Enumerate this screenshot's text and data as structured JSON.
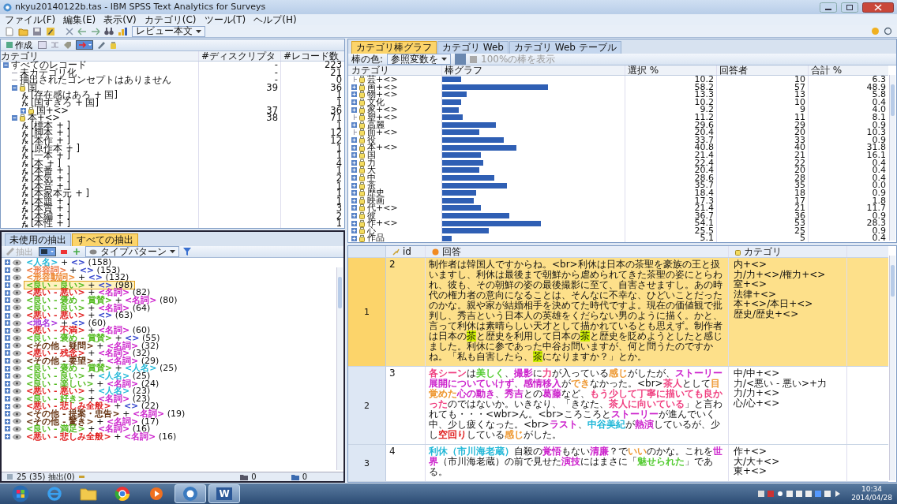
{
  "window": {
    "title": "nkyu20140122b.tas - IBM SPSS Text Analytics for Surveys"
  },
  "menu": [
    "ファイル(F)",
    "編集(E)",
    "表示(V)",
    "カテゴリ(C)",
    "ツール(T)",
    "ヘルプ(H)"
  ],
  "toolbar": {
    "view_dropdown": "レビュー本文"
  },
  "categories": {
    "create_button": "作成",
    "columns": [
      "カテゴリ",
      "#ディスクリプタ",
      "#レコード数"
    ],
    "rows": [
      {
        "label": "すべてのレコード",
        "descriptors": "-",
        "records": "223",
        "expanded": true,
        "children": [
          {
            "kind": "plain",
            "label": "未カテゴリ化",
            "descriptors": "-",
            "records": "21"
          },
          {
            "kind": "plain",
            "label": "抽出されたコンセプトはありません",
            "descriptors": "-",
            "records": "0"
          },
          {
            "kind": "category",
            "label": "国",
            "descriptors": "39",
            "records": "36",
            "expanded": true,
            "children": [
              {
                "kind": "descriptor",
                "label": "[存在感はあろ + 国]",
                "records": "1"
              },
              {
                "kind": "descriptor",
                "label": "[国すぎろ + 国]",
                "records": "1"
              },
              {
                "kind": "category",
                "label": "国+<>",
                "descriptors": "37",
                "records": "36",
                "expanded": false
              }
            ]
          },
          {
            "kind": "category",
            "label": "本+<>",
            "descriptors": "38",
            "records": "71",
            "expanded": true,
            "children": [
              {
                "kind": "descriptor",
                "label": "[標本 + ]",
                "records": "1"
              },
              {
                "kind": "descriptor",
                "label": "[脚本 + ]",
                "records": "12"
              },
              {
                "kind": "descriptor",
                "label": "[本作 + ]",
                "records": "12"
              },
              {
                "kind": "descriptor",
                "label": "[原作本 + ]",
                "records": "1"
              },
              {
                "kind": "descriptor",
                "label": "[一本 + ]",
                "records": "1"
              },
              {
                "kind": "descriptor",
                "label": "[本 + ]",
                "records": "4"
              },
              {
                "kind": "descriptor",
                "label": "[本番 + ]",
                "records": "1"
              },
              {
                "kind": "descriptor",
                "label": "[本気 + ]",
                "records": "2"
              },
              {
                "kind": "descriptor",
                "label": "[本音 + ]",
                "records": "1"
              },
              {
                "kind": "descriptor",
                "label": "[本家本元 + ]",
                "records": "1"
              },
              {
                "kind": "descriptor",
                "label": "[本題 + ]",
                "records": "1"
              },
              {
                "kind": "descriptor",
                "label": "[本質 + ]",
                "records": "3"
              },
              {
                "kind": "descriptor",
                "label": "[本編 + ]",
                "records": "2"
              },
              {
                "kind": "descriptor",
                "label": "[本性 + ]",
                "records": "1"
              }
            ]
          }
        ]
      }
    ]
  },
  "extractions": {
    "tabs": [
      {
        "label": "未使用の抽出",
        "selected": false
      },
      {
        "label": "すべての抽出",
        "selected": true
      }
    ],
    "extract_button": "抽出",
    "type_dropdown": "タイプパターン",
    "items": [
      {
        "selected": false,
        "parts": [
          {
            "text": "<人名>",
            "color": "#22b8d8"
          },
          {
            "text": " + "
          },
          {
            "text": "<>",
            "color": "#3344cc"
          }
        ],
        "count": " (158)"
      },
      {
        "selected": false,
        "parts": [
          {
            "text": "<形容詞>",
            "color": "#ee7744"
          },
          {
            "text": " + "
          },
          {
            "text": "<>",
            "color": "#3344cc"
          }
        ],
        "count": " (153)"
      },
      {
        "selected": false,
        "parts": [
          {
            "text": "<形容動詞>",
            "color": "#ee8833"
          },
          {
            "text": " + "
          },
          {
            "text": "<>",
            "color": "#3344cc"
          }
        ],
        "count": " (132)"
      },
      {
        "selected": true,
        "parts": [
          {
            "text": "<良い - 良い>",
            "color": "#55bb22"
          },
          {
            "text": " + "
          },
          {
            "text": "<>",
            "color": "#3344cc"
          }
        ],
        "count": " (98)"
      },
      {
        "selected": false,
        "parts": [
          {
            "text": "<悪い - 悪い>",
            "color": "#e02020"
          },
          {
            "text": " + "
          },
          {
            "text": "<名詞>",
            "color": "#cc22cc"
          }
        ],
        "count": " (82)"
      },
      {
        "selected": false,
        "parts": [
          {
            "text": "<良い - 褒め - 賞賛>",
            "color": "#55bb22"
          },
          {
            "text": " + "
          },
          {
            "text": "<名詞>",
            "color": "#cc22cc"
          }
        ],
        "count": " (80)"
      },
      {
        "selected": false,
        "parts": [
          {
            "text": "<良い - 良い>",
            "color": "#55bb22"
          },
          {
            "text": " + "
          },
          {
            "text": "<名詞>",
            "color": "#cc22cc"
          }
        ],
        "count": " (64)"
      },
      {
        "selected": false,
        "parts": [
          {
            "text": "<悪い - 悪い>",
            "color": "#e02020"
          },
          {
            "text": " + "
          },
          {
            "text": "<>",
            "color": "#3344cc"
          }
        ],
        "count": " (63)"
      },
      {
        "selected": false,
        "parts": [
          {
            "text": "<地名>",
            "color": "#aa33dd"
          },
          {
            "text": " + "
          },
          {
            "text": "<>",
            "color": "#3344cc"
          }
        ],
        "count": " (60)"
      },
      {
        "selected": false,
        "parts": [
          {
            "text": "<悪い - 不満>",
            "color": "#e02020"
          },
          {
            "text": " + "
          },
          {
            "text": "<名詞>",
            "color": "#cc22cc"
          }
        ],
        "count": " (60)"
      },
      {
        "selected": false,
        "parts": [
          {
            "text": "<良い - 褒め - 賞賛>",
            "color": "#55bb22"
          },
          {
            "text": " + "
          },
          {
            "text": "<>",
            "color": "#3344cc"
          }
        ],
        "count": " (55)"
      },
      {
        "selected": false,
        "parts": [
          {
            "text": "<その他 - 疑問>",
            "color": "#663311"
          },
          {
            "text": " + "
          },
          {
            "text": "<名詞>",
            "color": "#cc22cc"
          }
        ],
        "count": " (32)"
      },
      {
        "selected": false,
        "parts": [
          {
            "text": "<悪い - 残念>",
            "color": "#e02020"
          },
          {
            "text": " + "
          },
          {
            "text": "<名詞>",
            "color": "#cc22cc"
          }
        ],
        "count": " (32)"
      },
      {
        "selected": false,
        "parts": [
          {
            "text": "<その他 - 要望>",
            "color": "#663311"
          },
          {
            "text": " + "
          },
          {
            "text": "<名詞>",
            "color": "#cc22cc"
          }
        ],
        "count": " (29)"
      },
      {
        "selected": false,
        "parts": [
          {
            "text": "<良い - 褒め - 賞賛>",
            "color": "#55bb22"
          },
          {
            "text": " + "
          },
          {
            "text": "<人名>",
            "color": "#22b8d8"
          }
        ],
        "count": " (25)"
      },
      {
        "selected": false,
        "parts": [
          {
            "text": "<良い - 良い>",
            "color": "#55bb22"
          },
          {
            "text": " + "
          },
          {
            "text": "<人名>",
            "color": "#22b8d8"
          }
        ],
        "count": " (25)"
      },
      {
        "selected": false,
        "parts": [
          {
            "text": "<良い - 楽しい>",
            "color": "#55bb22"
          },
          {
            "text": " + "
          },
          {
            "text": "<名詞>",
            "color": "#cc22cc"
          }
        ],
        "count": " (24)"
      },
      {
        "selected": false,
        "parts": [
          {
            "text": "<悪い - 悪い>",
            "color": "#e02020"
          },
          {
            "text": " + "
          },
          {
            "text": "<人名>",
            "color": "#22b8d8"
          }
        ],
        "count": " (23)"
      },
      {
        "selected": false,
        "parts": [
          {
            "text": "<良い - 好き>",
            "color": "#55bb22"
          },
          {
            "text": " + "
          },
          {
            "text": "<名詞>",
            "color": "#cc22cc"
          }
        ],
        "count": " (23)"
      },
      {
        "selected": false,
        "parts": [
          {
            "text": "<悪い - 悲しみ全般>",
            "color": "#e02020"
          },
          {
            "text": " + "
          },
          {
            "text": "<>",
            "color": "#3344cc"
          }
        ],
        "count": " (22)"
      },
      {
        "selected": false,
        "parts": [
          {
            "text": "<その他 - 提案・忠告>",
            "color": "#663311"
          },
          {
            "text": " + "
          },
          {
            "text": "<名詞>",
            "color": "#cc22cc"
          }
        ],
        "count": " (19)"
      },
      {
        "selected": false,
        "parts": [
          {
            "text": "<その他 - 驚き>",
            "color": "#663311"
          },
          {
            "text": " + "
          },
          {
            "text": "<名詞>",
            "color": "#cc22cc"
          }
        ],
        "count": " (17)"
      },
      {
        "selected": false,
        "parts": [
          {
            "text": "<良い - 満足>",
            "color": "#55bb22"
          },
          {
            "text": " + "
          },
          {
            "text": "<名詞>",
            "color": "#cc22cc"
          }
        ],
        "count": " (16)"
      },
      {
        "selected": false,
        "parts": [
          {
            "text": "<悪い - 悲しみ全般>",
            "color": "#e02020"
          },
          {
            "text": " + "
          },
          {
            "text": "<名詞>",
            "color": "#cc22cc"
          }
        ],
        "count": " (16)"
      }
    ],
    "status": {
      "text": "25 (35) 抽出(0)",
      "count_1": "0",
      "count_2": "0"
    }
  },
  "chart_panel": {
    "tabs": [
      {
        "label": "カテゴリ棒グラフ",
        "selected": true
      },
      {
        "label": "カテゴリ Web",
        "selected": false
      },
      {
        "label": "カテゴリ Web テーブル",
        "selected": false
      }
    ],
    "bar_color_label": "棒の色:",
    "bar_color_dropdown": "参照変数を",
    "show_full_bar": {
      "label": "100%の棒を表示",
      "checked": false
    },
    "columns": [
      "カテゴリ",
      "棒グラフ",
      "選択 %",
      "回答者",
      "合計 %"
    ],
    "rows": [
      {
        "category": "芸+<>",
        "expandable": false,
        "level": 0.102,
        "selected_pct": "10.2",
        "respondents": "10",
        "total_pct": "6.3"
      },
      {
        "category": "画+<>",
        "expandable": true,
        "level": 0.582,
        "selected_pct": "58.2",
        "respondents": "57",
        "total_pct": "48.9"
      },
      {
        "category": "物+<>",
        "expandable": true,
        "level": 0.133,
        "selected_pct": "13.3",
        "respondents": "13",
        "total_pct": "5.8"
      },
      {
        "category": "文化",
        "expandable": true,
        "level": 0.102,
        "selected_pct": "10.2",
        "respondents": "10",
        "total_pct": "0.4"
      },
      {
        "category": "家+<>",
        "expandable": true,
        "level": 0.092,
        "selected_pct": "9.2",
        "respondents": "9",
        "total_pct": "4.0"
      },
      {
        "category": "塑+<>",
        "expandable": false,
        "level": 0.112,
        "selected_pct": "11.2",
        "respondents": "11",
        "total_pct": "8.1"
      },
      {
        "category": "高麗",
        "expandable": true,
        "level": 0.296,
        "selected_pct": "29.6",
        "respondents": "29",
        "total_pct": "0.9"
      },
      {
        "category": "面+<>",
        "expandable": false,
        "level": 0.204,
        "selected_pct": "20.4",
        "respondents": "20",
        "total_pct": "10.3"
      },
      {
        "category": "役",
        "expandable": true,
        "level": 0.337,
        "selected_pct": "33.7",
        "respondents": "33",
        "total_pct": "0.9"
      },
      {
        "category": "本+<>",
        "expandable": true,
        "level": 0.408,
        "selected_pct": "40.8",
        "respondents": "40",
        "total_pct": "31.8"
      },
      {
        "category": "国",
        "expandable": true,
        "level": 0.214,
        "selected_pct": "21.4",
        "respondents": "21",
        "total_pct": "16.1"
      },
      {
        "category": "力",
        "expandable": true,
        "level": 0.224,
        "selected_pct": "22.4",
        "respondents": "22",
        "total_pct": "0.4"
      },
      {
        "category": "大",
        "expandable": true,
        "level": 0.204,
        "selected_pct": "20.4",
        "respondents": "20",
        "total_pct": "0.4"
      },
      {
        "category": "中",
        "expandable": true,
        "level": 0.286,
        "selected_pct": "28.6",
        "respondents": "28",
        "total_pct": "0.4"
      },
      {
        "category": "茶",
        "expandable": true,
        "level": 0.357,
        "selected_pct": "35.7",
        "respondents": "35",
        "total_pct": "0.0"
      },
      {
        "category": "歴史",
        "expandable": true,
        "level": 0.184,
        "selected_pct": "18.4",
        "respondents": "18",
        "total_pct": "0.9"
      },
      {
        "category": "映画",
        "expandable": true,
        "level": 0.173,
        "selected_pct": "17.3",
        "respondents": "17",
        "total_pct": "1.8"
      },
      {
        "category": "代+<>",
        "expandable": true,
        "level": 0.214,
        "selected_pct": "21.4",
        "respondents": "21",
        "total_pct": "11.7"
      },
      {
        "category": "彼",
        "expandable": true,
        "level": 0.367,
        "selected_pct": "36.7",
        "respondents": "36",
        "total_pct": "0.9"
      },
      {
        "category": "作+<>",
        "expandable": true,
        "level": 0.541,
        "selected_pct": "54.1",
        "respondents": "53",
        "total_pct": "28.3"
      },
      {
        "category": "心",
        "expandable": true,
        "level": 0.255,
        "selected_pct": "25.5",
        "respondents": "25",
        "total_pct": "0.9"
      },
      {
        "category": "作品",
        "expandable": true,
        "level": 0.051,
        "selected_pct": "5.1",
        "respondents": "5",
        "total_pct": "0.4"
      }
    ]
  },
  "responses": {
    "columns": [
      "id",
      "回答",
      "カテゴリ"
    ],
    "rows": [
      {
        "number": "1",
        "id": "2",
        "selected": true,
        "response": [
          {
            "text": "制作者は韓国人ですからね。<br>利休は日本の茶聖を豪族の王と扱いますし、利休は最後まで朝鮮から虐められてきた茶聖の姿にとらわれ、彼も、その朝鮮の姿の最後撮影に至て、自害させますし。あの時代の権力者の意向になることは、そんなに不幸な、ひどいことだったのかな。親や家が結婚相手を決めてた時代ですよ。現在の価値観で批判し、秀吉という日本人の英雄をくだらない男のように描く。かと、言って利休は素晴らしい天才として描かれているとも思えず。制作者は日本の"
          },
          {
            "text": "茶",
            "color": "#ccee00"
          },
          {
            "text": "と歴史を利用して日本の"
          },
          {
            "text": "茶",
            "color": "#ccee00"
          },
          {
            "text": "と歴史を貶めようとしたと感じました。利休に参であった中谷お問いますが、何と問うたのですかね。「私も自害したら、"
          },
          {
            "text": "茶",
            "color": "#ccee00"
          },
          {
            "text": "になりますか？」とか。"
          }
        ],
        "categories": [
          "内+<>",
          "力/力+<>/権力+<>",
          "室+<>",
          "法律+<>",
          "本+<>/本日+<>",
          "歴史/歴史+<>"
        ]
      },
      {
        "number": "2",
        "id": "3",
        "selected": false,
        "response": [
          {
            "text": "各シーン",
            "color": "#f04080"
          },
          {
            "text": "は"
          },
          {
            "text": "美しく",
            "color": "#55cc33"
          },
          {
            "text": "、"
          },
          {
            "text": "撮影",
            "color": "#cc22cc"
          },
          {
            "text": "に"
          },
          {
            "text": "力",
            "color": "#f04080"
          },
          {
            "text": "が入っている"
          },
          {
            "text": "感じ",
            "color": "#ee9933"
          },
          {
            "text": "がしたが、"
          },
          {
            "text": "ストーリー展開についていけず",
            "color": "#cc22cc"
          },
          {
            "text": "、"
          },
          {
            "text": "感情移入",
            "color": "#cc22cc"
          },
          {
            "text": "が"
          },
          {
            "text": "でき",
            "color": "#ee9933"
          },
          {
            "text": "なかった。<br>"
          },
          {
            "text": "茶人",
            "color": "#f04080"
          },
          {
            "text": "として"
          },
          {
            "text": "目覚めた",
            "color": "#ee9933"
          },
          {
            "text": "心の動き",
            "color": "#cc22cc"
          },
          {
            "text": "、"
          },
          {
            "text": "秀吉",
            "color": "#cc22cc"
          },
          {
            "text": "との"
          },
          {
            "text": "葛藤",
            "color": "#cc22cc"
          },
          {
            "text": "など、"
          },
          {
            "text": "もう少して丁寧に描いても良かった",
            "color": "#f04080"
          },
          {
            "text": "のではないか。いきなり、「きなた、"
          },
          {
            "text": "茶人に向いている",
            "color": "#f04080"
          },
          {
            "text": "」と言われても・・・<wbr>ん。<br>ころころと"
          },
          {
            "text": "ストーリー",
            "color": "#cc22cc"
          },
          {
            "text": "が進んでいく中、少し疲くなった。<br>"
          },
          {
            "text": "ラスト",
            "color": "#cc22cc"
          },
          {
            "text": "、"
          },
          {
            "text": "中谷美紀",
            "color": "#22b8d8"
          },
          {
            "text": "が"
          },
          {
            "text": "熱演",
            "color": "#cc22cc"
          },
          {
            "text": "しているが、少し"
          },
          {
            "text": "空回り",
            "color": "#e02020"
          },
          {
            "text": "している"
          },
          {
            "text": "感じ",
            "color": "#ee9933"
          },
          {
            "text": "がした。"
          }
        ],
        "categories": [
          "中/中+<>",
          "力/<悪い - 悪い>+力",
          "力/力+<>",
          "心/心+<>"
        ]
      },
      {
        "number": "3",
        "id": "4",
        "selected": false,
        "response": [
          {
            "text": "利休（市川海老蔵）",
            "color": "#22b8d8"
          },
          {
            "text": "自殺の"
          },
          {
            "text": "覚悟",
            "color": "#cc22cc"
          },
          {
            "text": "もない"
          },
          {
            "text": "清廉",
            "color": "#cc22cc"
          },
          {
            "text": "？で"
          },
          {
            "text": "いい",
            "color": "#ee9933"
          },
          {
            "text": "のかな。これを"
          },
          {
            "text": "世界",
            "color": "#cc22cc"
          },
          {
            "text": "（市川海老蔵）の前で見せた"
          },
          {
            "text": "演技",
            "color": "#cc22cc"
          },
          {
            "text": "にはまさに「"
          },
          {
            "text": "魅せられた",
            "color": "#55cc33"
          },
          {
            "text": "」である。"
          }
        ],
        "categories": [
          "作+<>",
          "大/大+<>",
          "東+<>"
        ]
      }
    ]
  },
  "taskbar": {
    "apps": [
      {
        "kind": "start",
        "active": false
      },
      {
        "kind": "browser",
        "active": false
      },
      {
        "kind": "folder",
        "active": false
      },
      {
        "kind": "chrome",
        "active": false
      },
      {
        "kind": "media",
        "active": false
      },
      {
        "kind": "spss",
        "active": true
      },
      {
        "kind": "word",
        "active": true,
        "label": "W"
      }
    ],
    "time": "10:34",
    "date": "2014/04/28"
  }
}
